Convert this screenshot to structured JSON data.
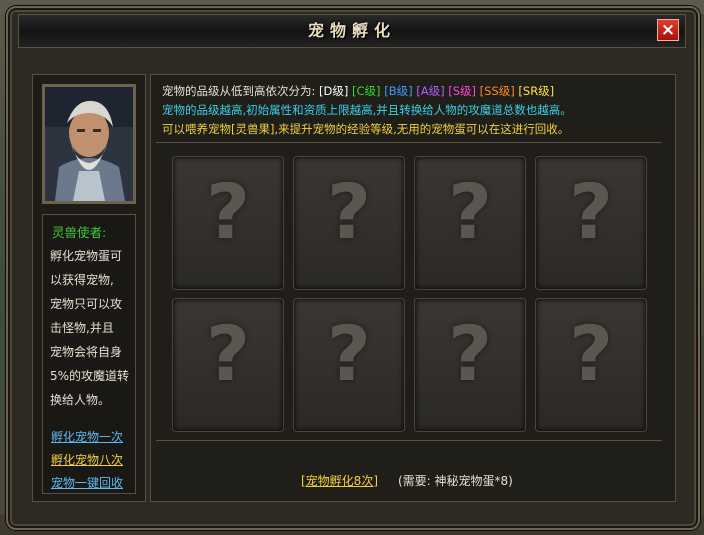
{
  "window": {
    "title": "宠物孵化",
    "close_label": "×"
  },
  "npc": {
    "name": "灵兽使者:",
    "description_lines": [
      "孵化宠物蛋可",
      "以获得宠物,",
      "宠物只可以攻",
      "击怪物,并且",
      "宠物会将自身",
      "5%的攻魔道转",
      "换给人物。"
    ],
    "links": [
      {
        "label": "孵化宠物一次",
        "color": "#5fb8f0"
      },
      {
        "label": "孵化宠物八次",
        "color": "#f0d040"
      },
      {
        "label": "宠物一键回收",
        "color": "#5fb8f0"
      }
    ]
  },
  "info": {
    "line1_prefix": "宠物的品级从低到高依次分为:",
    "grades": [
      {
        "label": "[D级]",
        "color": "#ffffff"
      },
      {
        "label": "[C级]",
        "color": "#33dd33"
      },
      {
        "label": "[B级]",
        "color": "#3aa0ff"
      },
      {
        "label": "[A级]",
        "color": "#b060ff"
      },
      {
        "label": "[S级]",
        "color": "#ff44dd"
      },
      {
        "label": "[SS级]",
        "color": "#ff8a20"
      },
      {
        "label": "[SR级]",
        "color": "#ffe040"
      }
    ],
    "line2": "宠物的品级越高,初始属性和资质上限越高,并且转换给人物的攻魔道总数也越高。",
    "line3": "可以喂养宠物[灵兽果],来提升宠物的经验等级,无用的宠物蛋可以在这进行回收。"
  },
  "egg_slots": [
    "?",
    "?",
    "?",
    "?",
    "?",
    "?",
    "?",
    "?"
  ],
  "hatch": {
    "button_label": "[宠物孵化8次]",
    "requirement": "(需要: 神秘宠物蛋*8)"
  },
  "colors": {
    "info_line2": "#3ad0e8",
    "info_line3": "#f0d040",
    "info_line1": "#e6e0cf"
  }
}
